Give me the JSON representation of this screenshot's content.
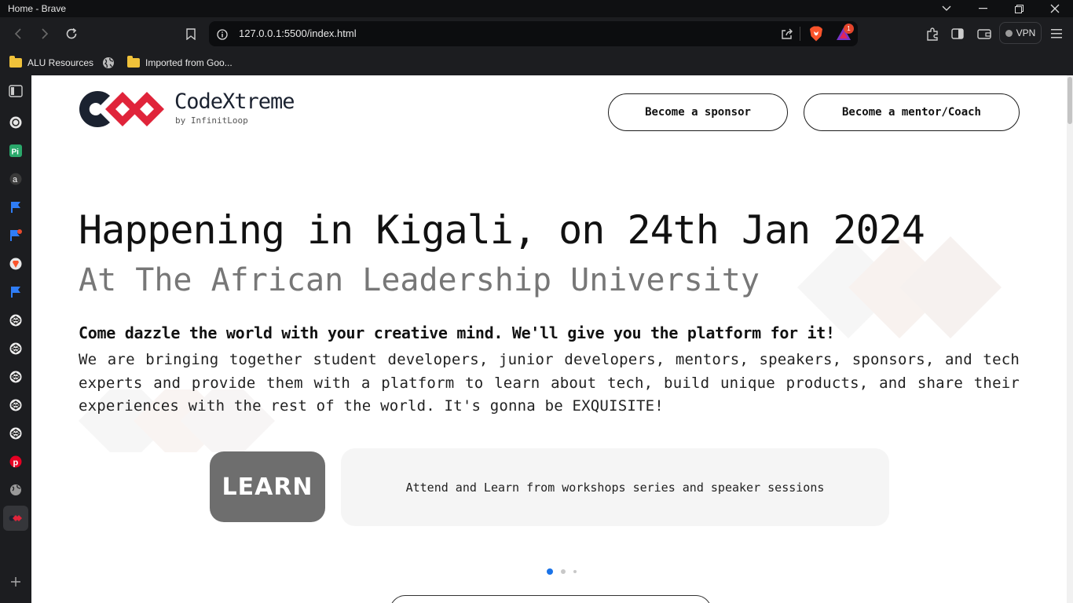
{
  "window": {
    "title": "Home - Brave"
  },
  "browser": {
    "url": "127.0.0.1:5500/index.html",
    "vpn_label": "VPN",
    "notification_count": "1",
    "bookmarks": [
      {
        "label": "ALU Resources",
        "icon": "folder-icon"
      },
      {
        "label": "",
        "icon": "globe-icon"
      },
      {
        "label": "Imported from Goo...",
        "icon": "folder-icon"
      }
    ]
  },
  "header": {
    "brand_name": "CodeXtreme",
    "brand_sub": "by InfinitLoop",
    "sponsor_button": "Become a sponsor",
    "mentor_button": "Become a mentor/Coach",
    "logo_colors": {
      "dark": "#1b2230",
      "accent": "#e0243a"
    }
  },
  "hero": {
    "title": "Happening in Kigali, on 24th Jan 2024",
    "subtitle": "At The African Leadership University",
    "lead": "Come dazzle the world with your creative mind. We'll give you the platform for it!",
    "body": "We are bringing together student developers, junior developers, mentors, speakers, sponsors, and tech experts and provide them with a platform to learn about tech, build unique products, and share their experiences with the rest of the world. It's gonna be EXQUISITE!"
  },
  "carousel": {
    "badge": "LEARN",
    "description": "Attend and Learn from workshops series and speaker sessions",
    "active_slide": 1,
    "slide_count": 3
  }
}
